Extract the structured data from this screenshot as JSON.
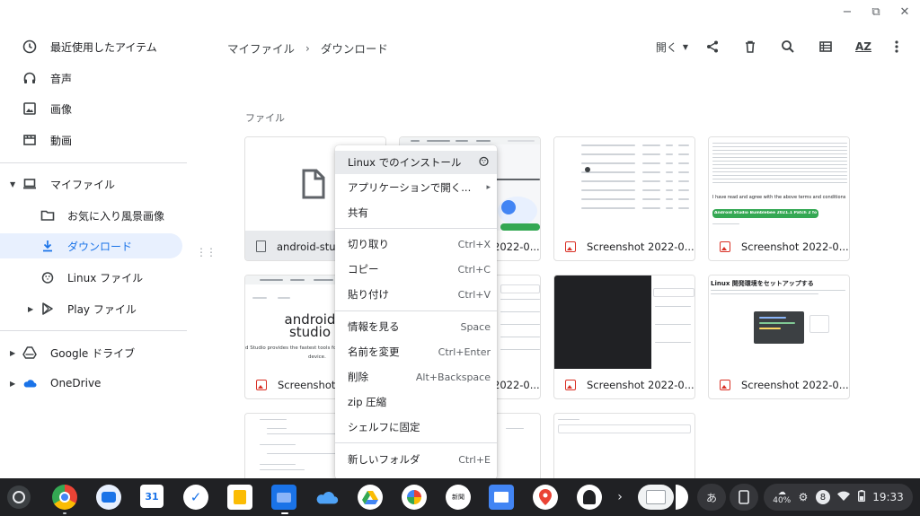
{
  "window": {
    "minimize": "−",
    "maximize": "⧉",
    "close": "✕"
  },
  "sidebar": {
    "recent": "最近使用したアイテム",
    "audio": "音声",
    "images": "画像",
    "videos": "動画",
    "my_files": "マイファイル",
    "favorites": "お気に入り風景画像",
    "downloads": "ダウンロード",
    "linux_files": "Linux ファイル",
    "play_files": "Play ファイル",
    "google_drive": "Google ドライブ",
    "onedrive": "OneDrive"
  },
  "breadcrumb": {
    "root": "マイファイル",
    "current": "ダウンロード"
  },
  "toolbar": {
    "open_label": "開く",
    "sort_label": "AZ"
  },
  "section_label": "ファイル",
  "files": [
    {
      "name": "android-studio",
      "type": "file"
    },
    {
      "name": "Screenshot 2022-0...",
      "type": "image"
    },
    {
      "name": "Screenshot 2022-0...",
      "type": "image"
    },
    {
      "name": "Screenshot 2022-0...",
      "type": "image"
    },
    {
      "name": "Screenshot 2...",
      "type": "image"
    },
    {
      "name": "Screenshot 2022-0...",
      "type": "image"
    },
    {
      "name": "Screenshot 2022-0...",
      "type": "image"
    },
    {
      "name": "Screenshot 2022-0...",
      "type": "image"
    }
  ],
  "thumb_text": {
    "as_brand_line1": "android",
    "as_brand_line2": "studio",
    "as_tagline": "d Studio provides the fastest tools for buildi",
    "as_tagline2": "device.",
    "linux_setup_title": "Linux 開発環境をセットアップする",
    "green_btn": "Android Studio Bumblebee 2021.1 Patch 2 for Chrome OS",
    "terms": "I have read and agree with the above terms and conditions"
  },
  "context_menu": {
    "items": [
      {
        "label": "Linux でのインストール",
        "shortcut": ""
      },
      {
        "label": "アプリケーションで開く...",
        "shortcut": "▸"
      },
      {
        "label": "共有",
        "shortcut": ""
      },
      {
        "label": "切り取り",
        "shortcut": "Ctrl+X"
      },
      {
        "label": "コピー",
        "shortcut": "Ctrl+C"
      },
      {
        "label": "貼り付け",
        "shortcut": "Ctrl+V"
      },
      {
        "label": "情報を見る",
        "shortcut": "Space"
      },
      {
        "label": "名前を変更",
        "shortcut": "Ctrl+Enter"
      },
      {
        "label": "削除",
        "shortcut": "Alt+Backspace"
      },
      {
        "label": "zip 圧縮",
        "shortcut": ""
      },
      {
        "label": "シェルフに固定",
        "shortcut": ""
      },
      {
        "label": "新しいフォルダ",
        "shortcut": "Ctrl+E"
      }
    ]
  },
  "shelf": {
    "ime": "あ",
    "battery_pct": "40%",
    "notif_count": "8",
    "time": "19:33",
    "calendar_day": "31"
  },
  "colors": {
    "accent": "#1a73e8",
    "active_bg": "#e8f0fe",
    "image_icon": "#d93025"
  }
}
